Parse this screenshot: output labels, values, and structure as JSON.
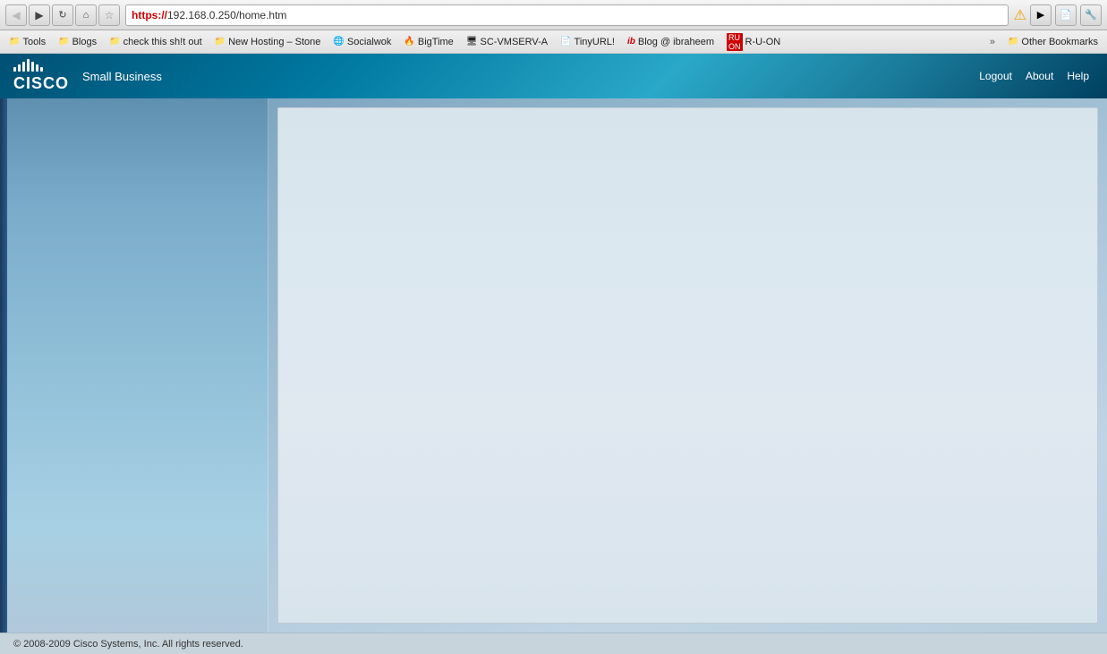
{
  "browser": {
    "url_https": "https://",
    "url_rest": "192.168.0.250/home.htm",
    "back_label": "◀",
    "forward_label": "▶",
    "refresh_label": "↻",
    "home_label": "⌂",
    "star_label": "☆",
    "warning_label": "⚠",
    "play_label": "▶",
    "page_label": "📄",
    "tools_label": "🔧"
  },
  "bookmarks": {
    "items": [
      {
        "label": "Tools",
        "type": "folder"
      },
      {
        "label": "Blogs",
        "type": "folder"
      },
      {
        "label": "check this sh!t out",
        "type": "folder"
      },
      {
        "label": "New Hosting – Stone",
        "type": "folder"
      },
      {
        "label": "Socialwok",
        "type": "site",
        "icon": "🌐"
      },
      {
        "label": "BigTime",
        "type": "site",
        "icon": "🔥"
      },
      {
        "label": "SC-VMSERV-A",
        "type": "site",
        "icon": "🖥"
      },
      {
        "label": "TinyURL!",
        "type": "page"
      },
      {
        "label": "Blog @ ibraheem",
        "type": "site",
        "icon": "ib"
      },
      {
        "label": "R-U-ON",
        "type": "site"
      }
    ],
    "overflow_label": "»",
    "other_label": "Other Bookmarks"
  },
  "header": {
    "brand": "CISCO",
    "subtitle": "Small Business",
    "nav_items": [
      {
        "label": "Logout"
      },
      {
        "label": "About"
      },
      {
        "label": "Help"
      }
    ]
  },
  "footer": {
    "copyright": "© 2008-2009 Cisco Systems, Inc. All rights reserved."
  }
}
